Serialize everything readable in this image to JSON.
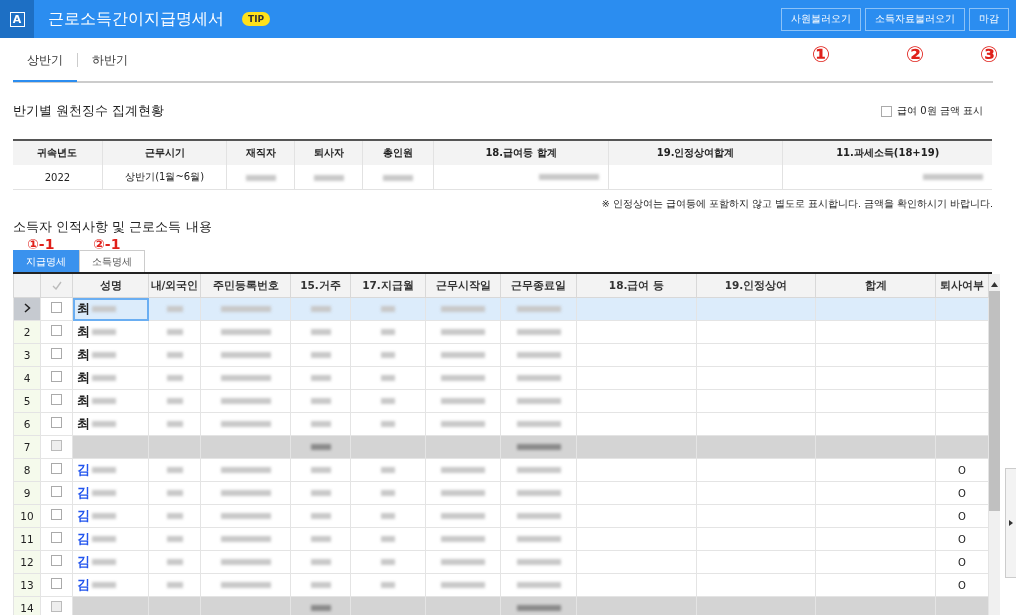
{
  "header": {
    "logo": "A",
    "title": "근로소득간이지급명세서",
    "tip": "TIP",
    "buttons": [
      {
        "label": "사원불러오기",
        "annotation": "①"
      },
      {
        "label": "소득자료불러오기",
        "annotation": "②"
      },
      {
        "label": "마감",
        "annotation": "③"
      }
    ]
  },
  "period_tabs": [
    {
      "label": "상반기",
      "selected": true
    },
    {
      "label": "하반기",
      "selected": false
    }
  ],
  "summary": {
    "title": "반기별 원천징수 집계현황",
    "zero_option": {
      "label": "급여 0원 금액 표시",
      "checked": false
    },
    "columns": [
      "귀속년도",
      "근무시기",
      "재직자",
      "퇴사자",
      "총인원",
      "18.급여등 합계",
      "19.인정상여합계",
      "11.과세소득(18+19)"
    ],
    "row": [
      "2022",
      "상반기(1월~6월)"
    ],
    "note": "※ 인정상여는 급여등에 포함하지 않고 별도로 표시합니다. 금액을 확인하시기 바랍니다."
  },
  "detail": {
    "title": "소득자 인적사항 및 근로소득 내용",
    "tabs": [
      {
        "label": "지급명세",
        "selected": true,
        "annotation": "①-1"
      },
      {
        "label": "소득명세",
        "selected": false,
        "annotation": "②-1"
      }
    ],
    "columns": [
      "성명",
      "내/외국인",
      "주민등록번호",
      "15.거주",
      "17.지급월",
      "근무시작일",
      "근무종료일",
      "18.급여 등",
      "19.인정상여",
      "합계",
      "퇴사여부"
    ],
    "rows": [
      {
        "kind": "data",
        "selected": true,
        "checked": false,
        "name": "최",
        "color": "#222222"
      },
      {
        "kind": "data",
        "selected": false,
        "number": "2",
        "checked": false,
        "name": "최",
        "color": "#222222"
      },
      {
        "kind": "data",
        "selected": false,
        "number": "3",
        "checked": false,
        "name": "최",
        "color": "#222222"
      },
      {
        "kind": "data",
        "selected": false,
        "number": "4",
        "checked": false,
        "name": "최",
        "color": "#222222"
      },
      {
        "kind": "data",
        "selected": false,
        "number": "5",
        "checked": false,
        "name": "최",
        "color": "#222222"
      },
      {
        "kind": "data",
        "selected": false,
        "number": "6",
        "checked": false,
        "name": "최",
        "color": "#222222"
      },
      {
        "kind": "subtotal",
        "selected": false,
        "number": "7"
      },
      {
        "kind": "data",
        "selected": false,
        "number": "8",
        "checked": false,
        "name": "김",
        "color": "#2255ee",
        "resigned": "O"
      },
      {
        "kind": "data",
        "selected": false,
        "number": "9",
        "checked": false,
        "name": "김",
        "color": "#2255ee",
        "resigned": "O"
      },
      {
        "kind": "data",
        "selected": false,
        "number": "10",
        "checked": false,
        "name": "김",
        "color": "#2255ee",
        "resigned": "O"
      },
      {
        "kind": "data",
        "selected": false,
        "number": "11",
        "checked": false,
        "name": "김",
        "color": "#2255ee",
        "resigned": "O"
      },
      {
        "kind": "data",
        "selected": false,
        "number": "12",
        "checked": false,
        "name": "김",
        "color": "#2255ee",
        "resigned": "O"
      },
      {
        "kind": "data",
        "selected": false,
        "number": "13",
        "checked": false,
        "name": "김",
        "color": "#2255ee",
        "resigned": "O"
      },
      {
        "kind": "subtotal",
        "selected": false,
        "number": "14"
      }
    ]
  }
}
